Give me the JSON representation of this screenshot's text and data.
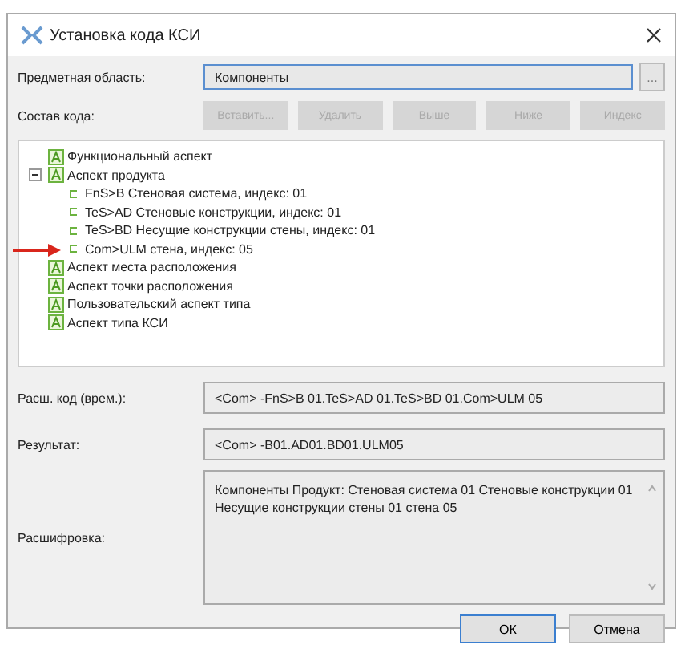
{
  "window": {
    "title": "Установка кода КСИ"
  },
  "subject": {
    "label": "Предметная область:",
    "value": "Компоненты",
    "browse": "..."
  },
  "composition": {
    "label": "Состав кода:",
    "buttons": [
      {
        "label": "Вставить...",
        "disabled": true
      },
      {
        "label": "Удалить",
        "disabled": true
      },
      {
        "label": "Выше",
        "disabled": true
      },
      {
        "label": "Ниже",
        "disabled": true
      },
      {
        "label": "Индекс",
        "disabled": true
      }
    ]
  },
  "tree": [
    {
      "kind": "aspect",
      "label": "Функциональный аспект"
    },
    {
      "kind": "aspect",
      "label": "Аспект продукта",
      "expanded": true,
      "children": [
        {
          "kind": "element",
          "label": "FnS>B Стеновая система, индекс: 01"
        },
        {
          "kind": "element",
          "label": "TeS>AD Стеновые конструкции, индекс: 01"
        },
        {
          "kind": "element",
          "label": "TeS>BD Несущие конструкции стены, индекс: 01"
        },
        {
          "kind": "element",
          "label": "Com>ULM стена, индекс: 05",
          "pointed": true
        }
      ]
    },
    {
      "kind": "aspect",
      "label": "Аспект места расположения"
    },
    {
      "kind": "aspect",
      "label": "Аспект точки расположения"
    },
    {
      "kind": "aspect",
      "label": "Пользовательский аспект типа"
    },
    {
      "kind": "aspect",
      "label": "Аспект типа КСИ"
    }
  ],
  "fields": [
    {
      "label": "Расш. код (врем.):",
      "value": "<Com> -FnS>B 01.TeS>AD 01.TeS>BD 01.Com>ULM 05"
    },
    {
      "label": "Результат:",
      "value": "<Com> -B01.AD01.BD01.ULM05"
    }
  ],
  "decoding": {
    "label": "Расшифровка:",
    "value": "Компоненты Продукт: Стеновая система 01 Стеновые конструкции 01 Несущие конструкции стены 01 стена 05"
  },
  "buttons": [
    {
      "label": "ОК",
      "default": true
    },
    {
      "label": "Отмена",
      "default": false
    }
  ]
}
